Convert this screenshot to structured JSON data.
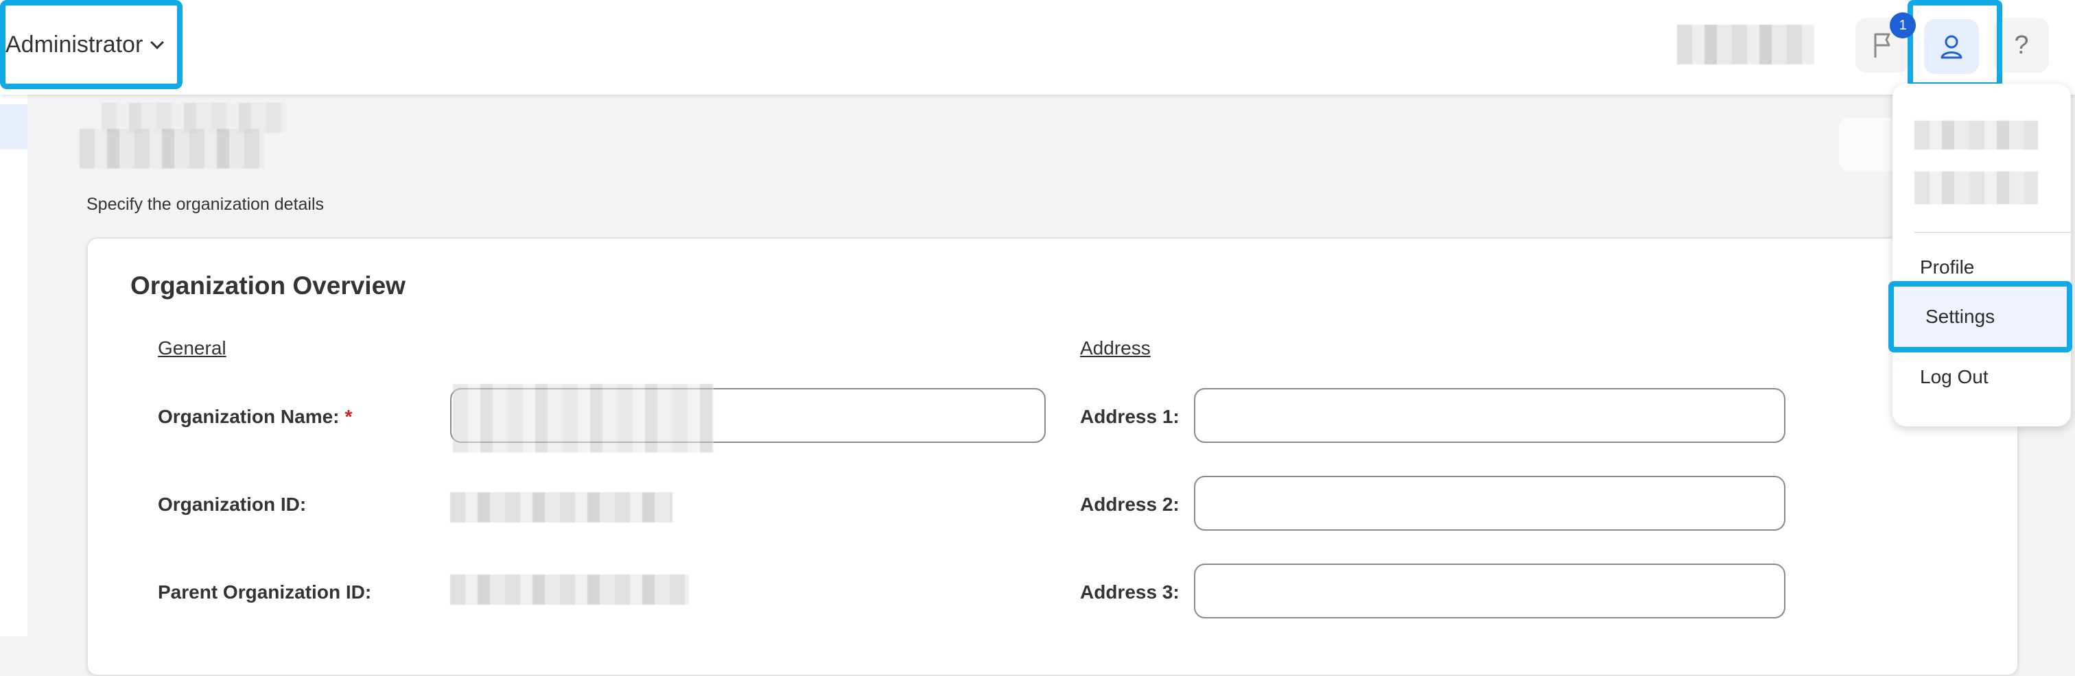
{
  "topbar": {
    "role": "Administrator",
    "notifications_count": "1",
    "help_label": "?"
  },
  "page": {
    "subtitle": "Specify the organization details"
  },
  "card": {
    "title": "Organization Overview",
    "general_heading": "General",
    "address_heading": "Address",
    "fields": {
      "org_name_label": "Organization Name:",
      "org_name_required": "*",
      "org_id_label": "Organization ID:",
      "parent_org_id_label": "Parent Organization ID:",
      "address1_label": "Address 1:",
      "address2_label": "Address 2:",
      "address3_label": "Address 3:"
    }
  },
  "user_menu": {
    "items": [
      "Profile",
      "Settings",
      "Log Out"
    ]
  },
  "colors": {
    "highlight": "#12a9e6",
    "accent": "#1d5fd6",
    "required": "#d62020"
  },
  "icons": {
    "role_chevron": "chevron-down-icon",
    "notifications": "flag-icon",
    "profile": "user-icon",
    "help": "question-icon"
  }
}
